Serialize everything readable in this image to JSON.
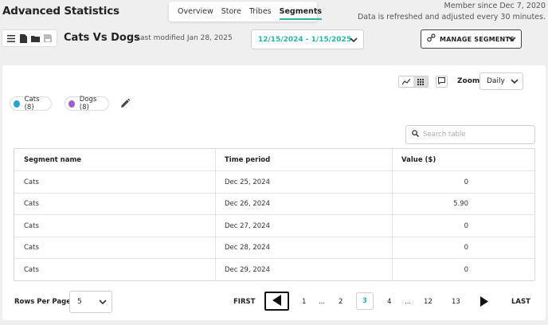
{
  "header": {
    "title": "Advanced Statistics",
    "tabs": [
      "Overview",
      "Store",
      "Tribes",
      "Segments"
    ],
    "active_tab": "Segments",
    "member_since": "Member since Dec 7, 2020",
    "refresh_note": "Data is refreshed and adjusted every 30 minutes."
  },
  "toolbar": {
    "report_title": "Cats Vs Dogs",
    "modified": "Last modified Jan 28, 2025",
    "date_range": "12/15/2024 - 1/15/2025",
    "manage_label": "MANAGE SEGMENTS",
    "icons": [
      "menu-icon",
      "file-icon",
      "folder-icon",
      "save-icon"
    ]
  },
  "controls": {
    "zoom_label": "Zoom",
    "zoom_value": "Daily",
    "search_placeholder": "Search table"
  },
  "segments": [
    {
      "label": "Cats (8)",
      "color": "#1fa6d4"
    },
    {
      "label": "Dogs (8)",
      "color": "#a05bd6"
    }
  ],
  "table": {
    "headers": [
      "Segment name",
      "Time period",
      "Value ($)"
    ],
    "rows": [
      [
        "Cats",
        "Dec 25, 2024",
        "0"
      ],
      [
        "Cats",
        "Dec 26, 2024",
        "5.90"
      ],
      [
        "Cats",
        "Dec 27, 2024",
        "0"
      ],
      [
        "Cats",
        "Dec 28, 2024",
        "0"
      ],
      [
        "Cats",
        "Dec 29, 2024",
        "0"
      ]
    ]
  },
  "pagination": {
    "rows_per_page_label": "Rows Per Page",
    "rows_per_page": "5",
    "first": "FIRST",
    "last": "LAST",
    "pages": [
      "1",
      "...",
      "2",
      "3",
      "4",
      "...",
      "12",
      "13"
    ],
    "current": "3"
  },
  "colors": {
    "accent": "#2bb5a5",
    "background": "#efefef"
  }
}
